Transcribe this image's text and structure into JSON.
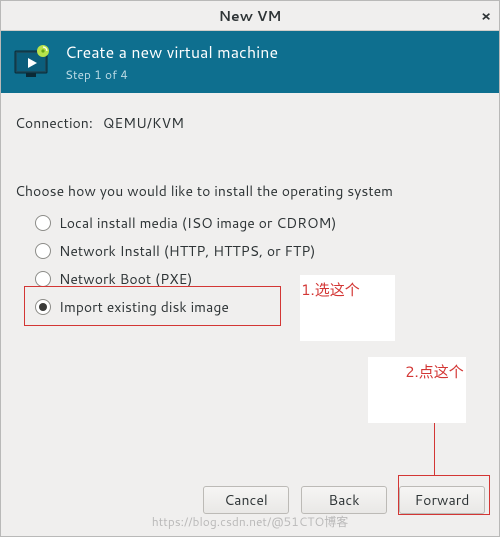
{
  "window": {
    "title": "New VM",
    "close_glyph": "×"
  },
  "header": {
    "title": "Create a new virtual machine",
    "step": "Step 1 of 4"
  },
  "connection": {
    "label": "Connection:",
    "value": "QEMU/KVM"
  },
  "prompt": "Choose how you would like to install the operating system",
  "options": [
    {
      "label": "Local install media (ISO image or CDROM)",
      "selected": false
    },
    {
      "label": "Network Install (HTTP, HTTPS, or FTP)",
      "selected": false
    },
    {
      "label": "Network Boot (PXE)",
      "selected": false
    },
    {
      "label": "Import existing disk image",
      "selected": true
    }
  ],
  "annotations": {
    "hint1": "1.选这个",
    "hint2": "2.点这个"
  },
  "buttons": {
    "cancel": "Cancel",
    "back": "Back",
    "forward": "Forward"
  },
  "watermark": "https://blog.csdn.net/@51CTO博客"
}
